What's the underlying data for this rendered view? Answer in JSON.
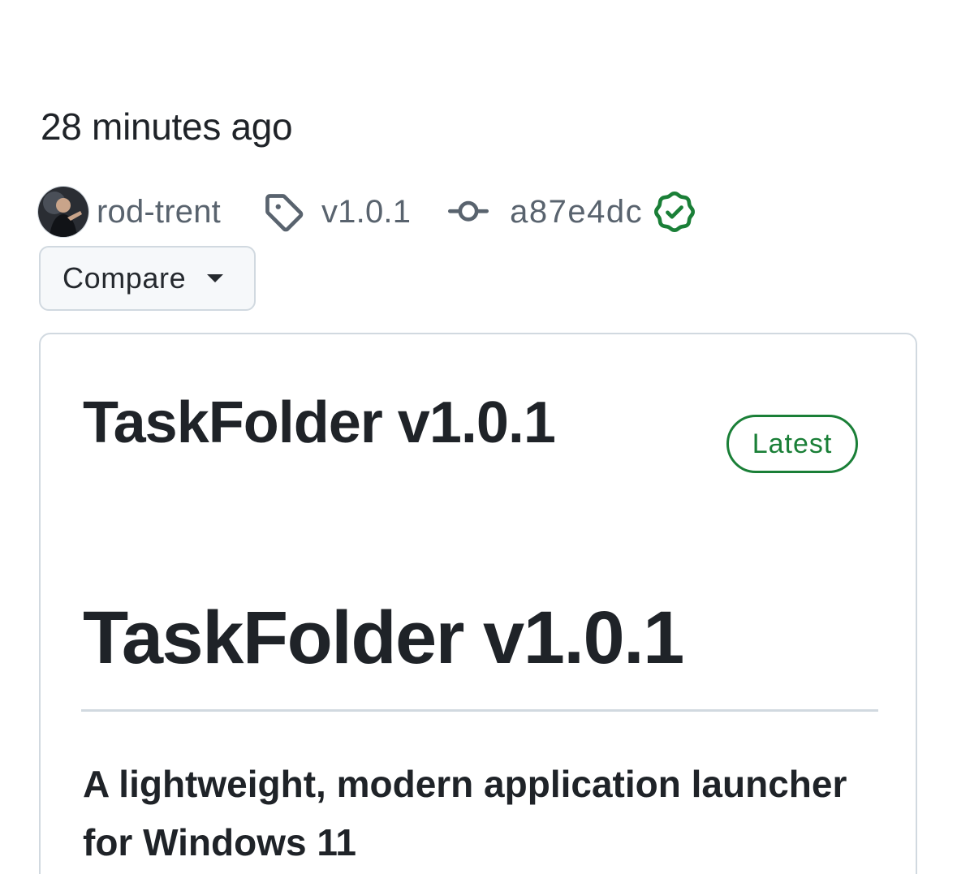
{
  "release": {
    "timestamp": "28 minutes ago",
    "author": {
      "username": "rod-trent",
      "avatar_icon": "user-avatar"
    },
    "tag": {
      "icon": "tag-icon",
      "label": "v1.0.1"
    },
    "commit": {
      "icon": "git-commit-icon",
      "sha": "a87e4dc",
      "verified_icon": "verified-badge-icon"
    },
    "compare_button": {
      "label": "Compare",
      "icon": "triangle-down-icon"
    },
    "card": {
      "title": "TaskFolder v1.0.1",
      "badge": "Latest",
      "body": {
        "heading": "TaskFolder v1.0.1",
        "subheading": "A lightweight, modern application launcher for Windows 11"
      }
    }
  },
  "colors": {
    "text_primary": "#1f2328",
    "text_muted": "#59636e",
    "border": "#d1d9e0",
    "button_bg": "#f6f8fa",
    "success_green": "#1a7f37"
  }
}
